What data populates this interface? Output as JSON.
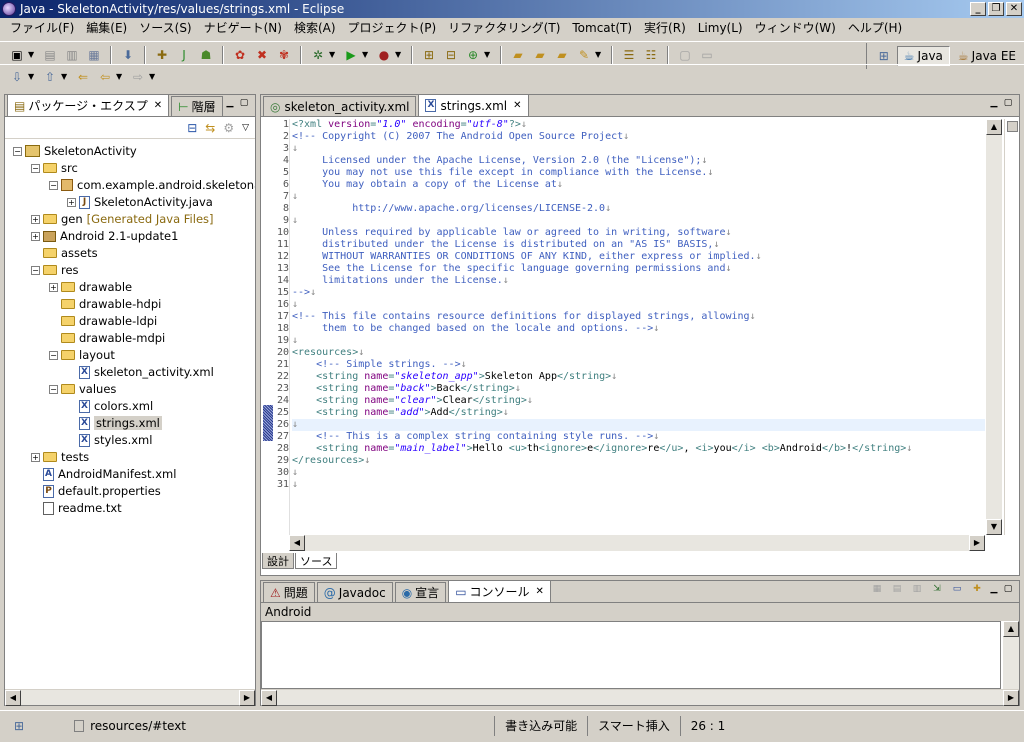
{
  "window": {
    "title": "Java - SkeletonActivity/res/values/strings.xml - Eclipse",
    "controls": [
      "_",
      "❐",
      "✕"
    ]
  },
  "menu": [
    "ファイル(F)",
    "編集(E)",
    "ソース(S)",
    "ナビゲート(N)",
    "検索(A)",
    "プロジェクト(P)",
    "リファクタリング(T)",
    "Tomcat(T)",
    "実行(R)",
    "Limy(L)",
    "ウィンドウ(W)",
    "ヘルプ(H)"
  ],
  "perspectives": {
    "java": "Java",
    "javaee": "Java EE"
  },
  "package_explorer": {
    "tab_label": "パッケージ・エクスプ",
    "hierarchy_tab": "階層",
    "tree": [
      {
        "label": "SkeletonActivity",
        "icon": "project-icon",
        "expander": "−"
      },
      {
        "label": "src",
        "icon": "source-folder-icon",
        "expander": "−"
      },
      {
        "label": "com.example.android.skeletonapp",
        "icon": "package-icon",
        "expander": "−"
      },
      {
        "label": "SkeletonActivity.java",
        "icon": "java-file-icon",
        "expander": "+"
      },
      {
        "label": "gen",
        "note": "[Generated Java Files]",
        "icon": "source-folder-icon",
        "expander": "+"
      },
      {
        "label": "Android 2.1-update1",
        "icon": "library-icon",
        "expander": "+"
      },
      {
        "label": "assets",
        "icon": "folder-icon",
        "expander": ""
      },
      {
        "label": "res",
        "icon": "folder-icon",
        "expander": "−"
      },
      {
        "label": "drawable",
        "icon": "folder-icon",
        "expander": "+"
      },
      {
        "label": "drawable-hdpi",
        "icon": "folder-icon",
        "expander": ""
      },
      {
        "label": "drawable-ldpi",
        "icon": "folder-icon",
        "expander": ""
      },
      {
        "label": "drawable-mdpi",
        "icon": "folder-icon",
        "expander": ""
      },
      {
        "label": "layout",
        "icon": "folder-icon",
        "expander": "−"
      },
      {
        "label": "skeleton_activity.xml",
        "icon": "xml-file-icon",
        "expander": ""
      },
      {
        "label": "values",
        "icon": "folder-icon",
        "expander": "−"
      },
      {
        "label": "colors.xml",
        "icon": "xml-file-icon",
        "expander": ""
      },
      {
        "label": "strings.xml",
        "icon": "xml-file-icon",
        "expander": "",
        "selected": true
      },
      {
        "label": "styles.xml",
        "icon": "xml-file-icon",
        "expander": ""
      },
      {
        "label": "tests",
        "icon": "folder-icon",
        "expander": "+"
      },
      {
        "label": "AndroidManifest.xml",
        "icon": "manifest-file-icon",
        "expander": ""
      },
      {
        "label": "default.properties",
        "icon": "properties-file-icon",
        "expander": ""
      },
      {
        "label": "readme.txt",
        "icon": "text-file-icon",
        "expander": ""
      }
    ]
  },
  "editor": {
    "tabs": [
      {
        "label": "skeleton_activity.xml",
        "active": false
      },
      {
        "label": "strings.xml",
        "active": true
      }
    ],
    "bottom_tabs": [
      "設計",
      "ソース"
    ],
    "line_numbers": [
      "1",
      "2",
      "3",
      "4",
      "5",
      "6",
      "7",
      "8",
      "9",
      "10",
      "11",
      "12",
      "13",
      "14",
      "15",
      "16",
      "17",
      "18",
      "19",
      "20",
      "21",
      "22",
      "23",
      "24",
      "25",
      "26",
      "27",
      "28",
      "29",
      "30",
      "31"
    ],
    "current_line": 26,
    "lines": [
      "<?xml version=\"1.0\" encoding=\"utf-8\"?>",
      "<!-- Copyright (C) 2007 The Android Open Source Project",
      "",
      "     Licensed under the Apache License, Version 2.0 (the \"License\");",
      "     you may not use this file except in compliance with the License.",
      "     You may obtain a copy of the License at",
      "",
      "          http://www.apache.org/licenses/LICENSE-2.0",
      "",
      "     Unless required by applicable law or agreed to in writing, software",
      "     distributed under the License is distributed on an \"AS IS\" BASIS,",
      "     WITHOUT WARRANTIES OR CONDITIONS OF ANY KIND, either express or implied.",
      "     See the License for the specific language governing permissions and",
      "     limitations under the License.",
      "-->",
      "",
      "<!-- This file contains resource definitions for displayed strings, allowing",
      "     them to be changed based on the locale and options. -->",
      "",
      "<resources>",
      "    <!-- Simple strings. -->",
      "    <string name=\"skeleton_app\">Skeleton App</string>",
      "    <string name=\"back\">Back</string>",
      "    <string name=\"clear\">Clear</string>",
      "    <string name=\"add\">Add</string>",
      "",
      "    <!-- This is a complex string containing style runs. -->",
      "    <string name=\"main_label\">Hello <u>th<ignore>e</ignore>re</u>, <i>you</i> <b>Android</b>!</string>",
      "</resources>",
      "",
      ""
    ]
  },
  "console_panel": {
    "tabs": [
      {
        "label": "問題",
        "icon": "problems-icon"
      },
      {
        "label": "Javadoc",
        "icon": "javadoc-icon"
      },
      {
        "label": "宣言",
        "icon": "declaration-icon"
      },
      {
        "label": "コンソール",
        "icon": "console-icon",
        "active": true
      }
    ],
    "console_name": "Android"
  },
  "status_bar": {
    "path": "resources/#text",
    "writable": "書き込み可能",
    "insert_mode": "スマート挿入",
    "position": "26 : 1"
  }
}
